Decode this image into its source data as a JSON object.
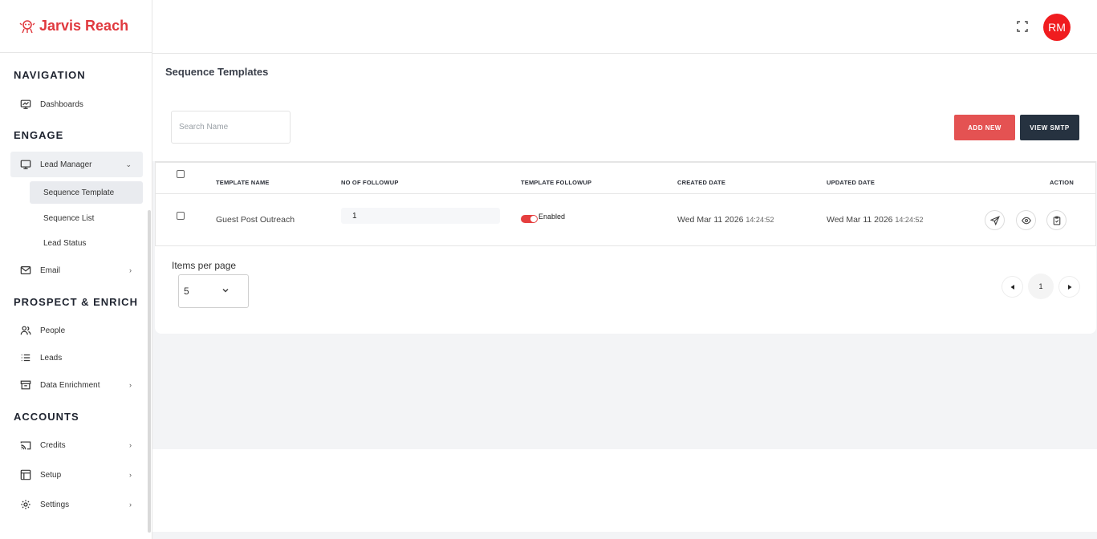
{
  "brand": {
    "name": "Jarvis Reach",
    "color": "#e0393e"
  },
  "header": {
    "avatar_initials": "RM",
    "avatar_color": "#f01c1f",
    "fullscreen_icon": "expand-icon"
  },
  "sidebar": {
    "sections": {
      "navigation": "NAVIGATION",
      "engage": "ENGAGE",
      "prospect": "PROSPECT & ENRICH",
      "accounts": "ACCOUNTS"
    },
    "items": {
      "dashboards": "Dashboards",
      "lead_manager": "Lead Manager",
      "sequence_template": "Sequence Template",
      "sequence_list": "Sequence List",
      "lead_status": "Lead Status",
      "email": "Email",
      "people": "People",
      "leads": "Leads",
      "data_enrichment": "Data Enrichment",
      "credits": "Credits",
      "setup": "Setup",
      "settings": "Settings"
    }
  },
  "page": {
    "title": "Sequence Templates",
    "search_placeholder": "Search Name",
    "add_new_label": "ADD NEW",
    "add_new_color": "#e45252",
    "view_smtp_label": "VIEW SMTP",
    "view_smtp_color": "#263240"
  },
  "table": {
    "headers": {
      "name": "TEMPLATE NAME",
      "followup_count": "NO OF FOLLOWUP",
      "template_followup": "TEMPLATE FOLLOWUP",
      "created": "CREATED DATE",
      "updated": "UPDATED DATE",
      "action": "ACTION"
    },
    "rows": [
      {
        "name": "Guest Post Outreach",
        "followup_count": "1",
        "toggle_label": "Enabled",
        "created_date": "Wed Mar 11 2026",
        "created_time": "14:24:52",
        "updated_date": "Wed Mar 11 2026",
        "updated_time": "14:24:52"
      }
    ]
  },
  "pagination": {
    "items_per_page_label": "Items per page",
    "items_per_page_value": "5",
    "current_page": "1"
  }
}
